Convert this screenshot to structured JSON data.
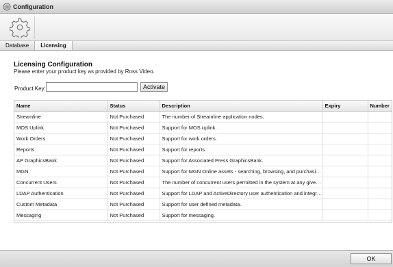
{
  "window": {
    "title": "Configuration",
    "icon": "gear-icon"
  },
  "toolbar": {
    "icon": "gear-icon"
  },
  "tabs": [
    {
      "label": "Database",
      "active": false
    },
    {
      "label": "Licensing",
      "active": true
    }
  ],
  "licensing": {
    "heading": "Licensing Configuration",
    "subtitle": "Please enter your product key as provided by Ross Video.",
    "product_key_label": "Product Key:",
    "product_key_value": "",
    "activate_label": "Activate"
  },
  "table": {
    "headers": {
      "name": "Name",
      "status": "Status",
      "description": "Description",
      "expiry": "Expiry",
      "number": "Number"
    },
    "rows": [
      {
        "name": "Streamline",
        "status": "Not Purchased",
        "description": "The number of Streamline application nodes.",
        "expiry": "",
        "number": ""
      },
      {
        "name": "MOS Uplink",
        "status": "Not Purchased",
        "description": "Support for MOS uplink.",
        "expiry": "",
        "number": ""
      },
      {
        "name": "Work Orders",
        "status": "Not Purchased",
        "description": "Support for work orders.",
        "expiry": "",
        "number": ""
      },
      {
        "name": "Reports",
        "status": "Not Purchased",
        "description": "Support for reports.",
        "expiry": "",
        "number": ""
      },
      {
        "name": "AP GraphicsBank",
        "status": "Not Purchased",
        "description": "Support for Associated Press GraphicsBank.",
        "expiry": "",
        "number": ""
      },
      {
        "name": "MGN",
        "status": "Not Purchased",
        "description": "Support for MGN Online assets - searching, browsing, and purchasing.",
        "expiry": "",
        "number": ""
      },
      {
        "name": "Concurrent Users",
        "status": "Not Purchased",
        "description": "The number of concurrent users permitted in the system at any given ti...",
        "expiry": "",
        "number": ""
      },
      {
        "name": "LDAP Authentication",
        "status": "Not Purchased",
        "description": "Support for LDAP and ActiveDirectory user authentication and integration.",
        "expiry": "",
        "number": ""
      },
      {
        "name": "Custom Metadata",
        "status": "Not Purchased",
        "description": "Support for user defined metadata.",
        "expiry": "",
        "number": ""
      },
      {
        "name": "Messaging",
        "status": "Not Purchased",
        "description": "Support for messaging.",
        "expiry": "",
        "number": ""
      }
    ]
  },
  "footer": {
    "ok_label": "OK"
  }
}
